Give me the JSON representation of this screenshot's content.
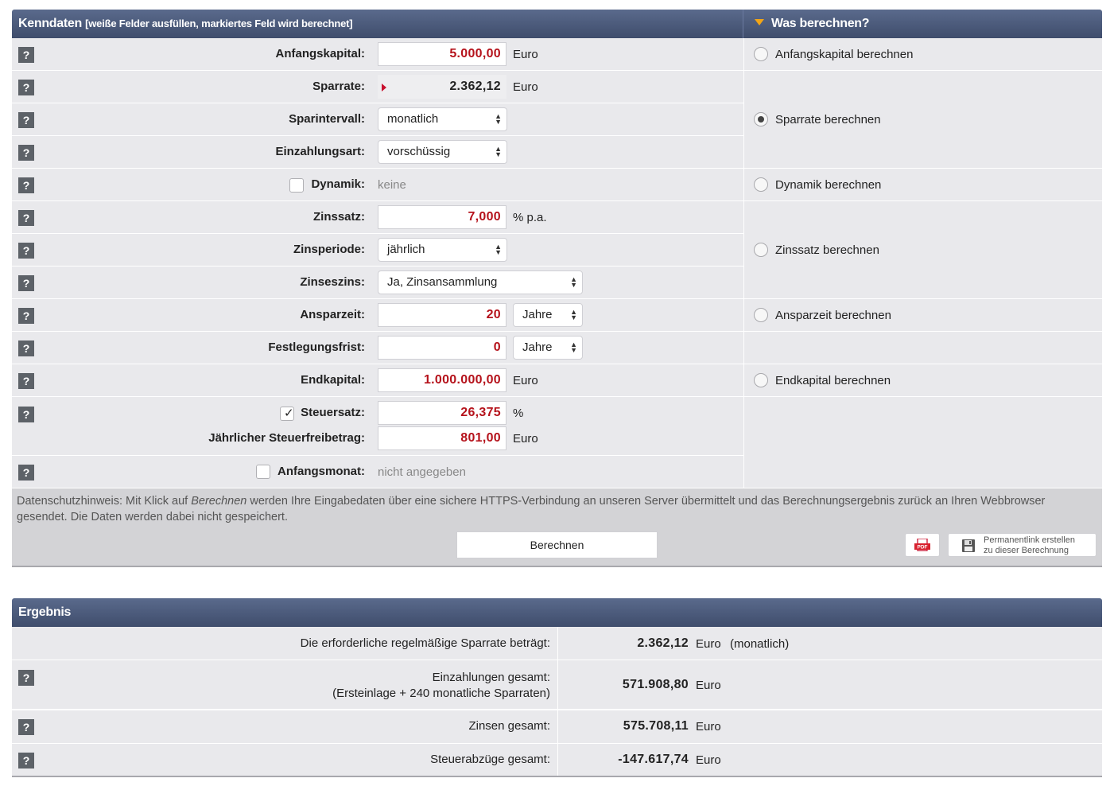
{
  "kenndaten": {
    "title": "Kenndaten",
    "subtitle": "[weiße Felder ausfüllen, markiertes Feld wird berechnet]",
    "was_berechnen": "Was berechnen?",
    "help_glyph": "?",
    "fields": {
      "anfangskapital": {
        "label": "Anfangskapital:",
        "value": "5.000,00",
        "unit": "Euro"
      },
      "sparrate": {
        "label": "Sparrate:",
        "value": "2.362,12",
        "unit": "Euro"
      },
      "sparintervall": {
        "label": "Sparintervall:",
        "value": "monatlich"
      },
      "einzahlungsart": {
        "label": "Einzahlungsart:",
        "value": "vorschüssig"
      },
      "dynamik": {
        "label": "Dynamik:",
        "value": "keine",
        "checked": false
      },
      "zinssatz": {
        "label": "Zinssatz:",
        "value": "7,000",
        "unit": "% p.a."
      },
      "zinsperiode": {
        "label": "Zinsperiode:",
        "value": "jährlich"
      },
      "zinseszins": {
        "label": "Zinseszins:",
        "value": "Ja, Zinsansammlung"
      },
      "ansparzeit": {
        "label": "Ansparzeit:",
        "value": "20",
        "unit": "Jahre"
      },
      "festlegungsfrist": {
        "label": "Festlegungsfrist:",
        "value": "0",
        "unit": "Jahre"
      },
      "endkapital": {
        "label": "Endkapital:",
        "value": "1.000.000,00",
        "unit": "Euro"
      },
      "steuersatz": {
        "label": "Steuersatz:",
        "value": "26,375",
        "unit": "%",
        "checked": true
      },
      "steuerfreibetrag": {
        "label": "Jährlicher Steuerfreibetrag:",
        "value": "801,00",
        "unit": "Euro"
      },
      "anfangsmonat": {
        "label": "Anfangsmonat:",
        "value": "nicht angegeben",
        "checked": false
      }
    },
    "radios": {
      "anfangskapital": "Anfangskapital berechnen",
      "sparrate": "Sparrate berechnen",
      "dynamik": "Dynamik berechnen",
      "zinssatz": "Zinssatz berechnen",
      "ansparzeit": "Ansparzeit berechnen",
      "endkapital": "Endkapital berechnen",
      "selected": "sparrate"
    },
    "note_prefix": "Datenschutzhinweis: Mit Klick auf ",
    "note_em": "Berechnen",
    "note_suffix": " werden Ihre Eingabedaten über eine sichere HTTPS-Verbindung an unseren Server übermittelt und das Berechnungsergebnis zurück an Ihren Webbrowser gesendet. Die Daten werden dabei nicht gespeichert.",
    "calc_button": "Berechnen",
    "pdf_label": "PDF",
    "permalink_line1": "Permanentlink erstellen",
    "permalink_line2": "zu dieser Berechnung"
  },
  "ergebnis": {
    "title": "Ergebnis",
    "rows": [
      {
        "label": "Die erforderliche regelmäßige Sparrate beträgt:",
        "value": "2.362,12",
        "unit": "Euro",
        "extra": "(monatlich)"
      },
      {
        "label": "Einzahlungen gesamt:",
        "label2": "(Ersteinlage + 240 monatliche Sparraten)",
        "value": "571.908,80",
        "unit": "Euro"
      },
      {
        "label": "Zinsen gesamt:",
        "value": "575.708,11",
        "unit": "Euro"
      },
      {
        "label": "Steuerabzüge gesamt:",
        "value": "-147.617,74",
        "unit": "Euro"
      }
    ]
  },
  "colors": {
    "header": "#46547a",
    "row_bg": "#e9e9ec",
    "input_value_red": "#b5121b",
    "accent_triangle": "#f2a516"
  }
}
